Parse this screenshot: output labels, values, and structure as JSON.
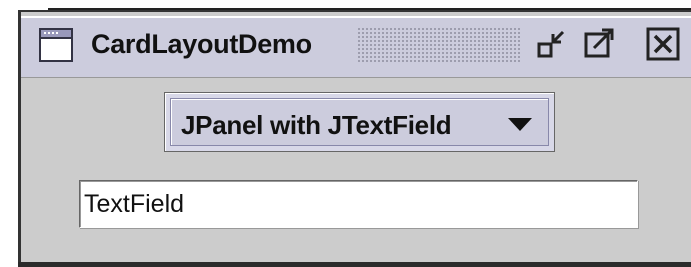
{
  "window": {
    "title": "CardLayoutDemo",
    "icons": {
      "app": "window-icon",
      "iconify": "iconify-icon",
      "maximize": "maximize-icon",
      "close": "close-icon"
    }
  },
  "combo": {
    "selected": "JPanel with JTextField",
    "arrow": "triangle-down-icon"
  },
  "textfield": {
    "value": "TextField"
  },
  "colors": {
    "titlebar": "#ccccdd",
    "panel": "#cccccc",
    "accent": "#8888aa"
  }
}
